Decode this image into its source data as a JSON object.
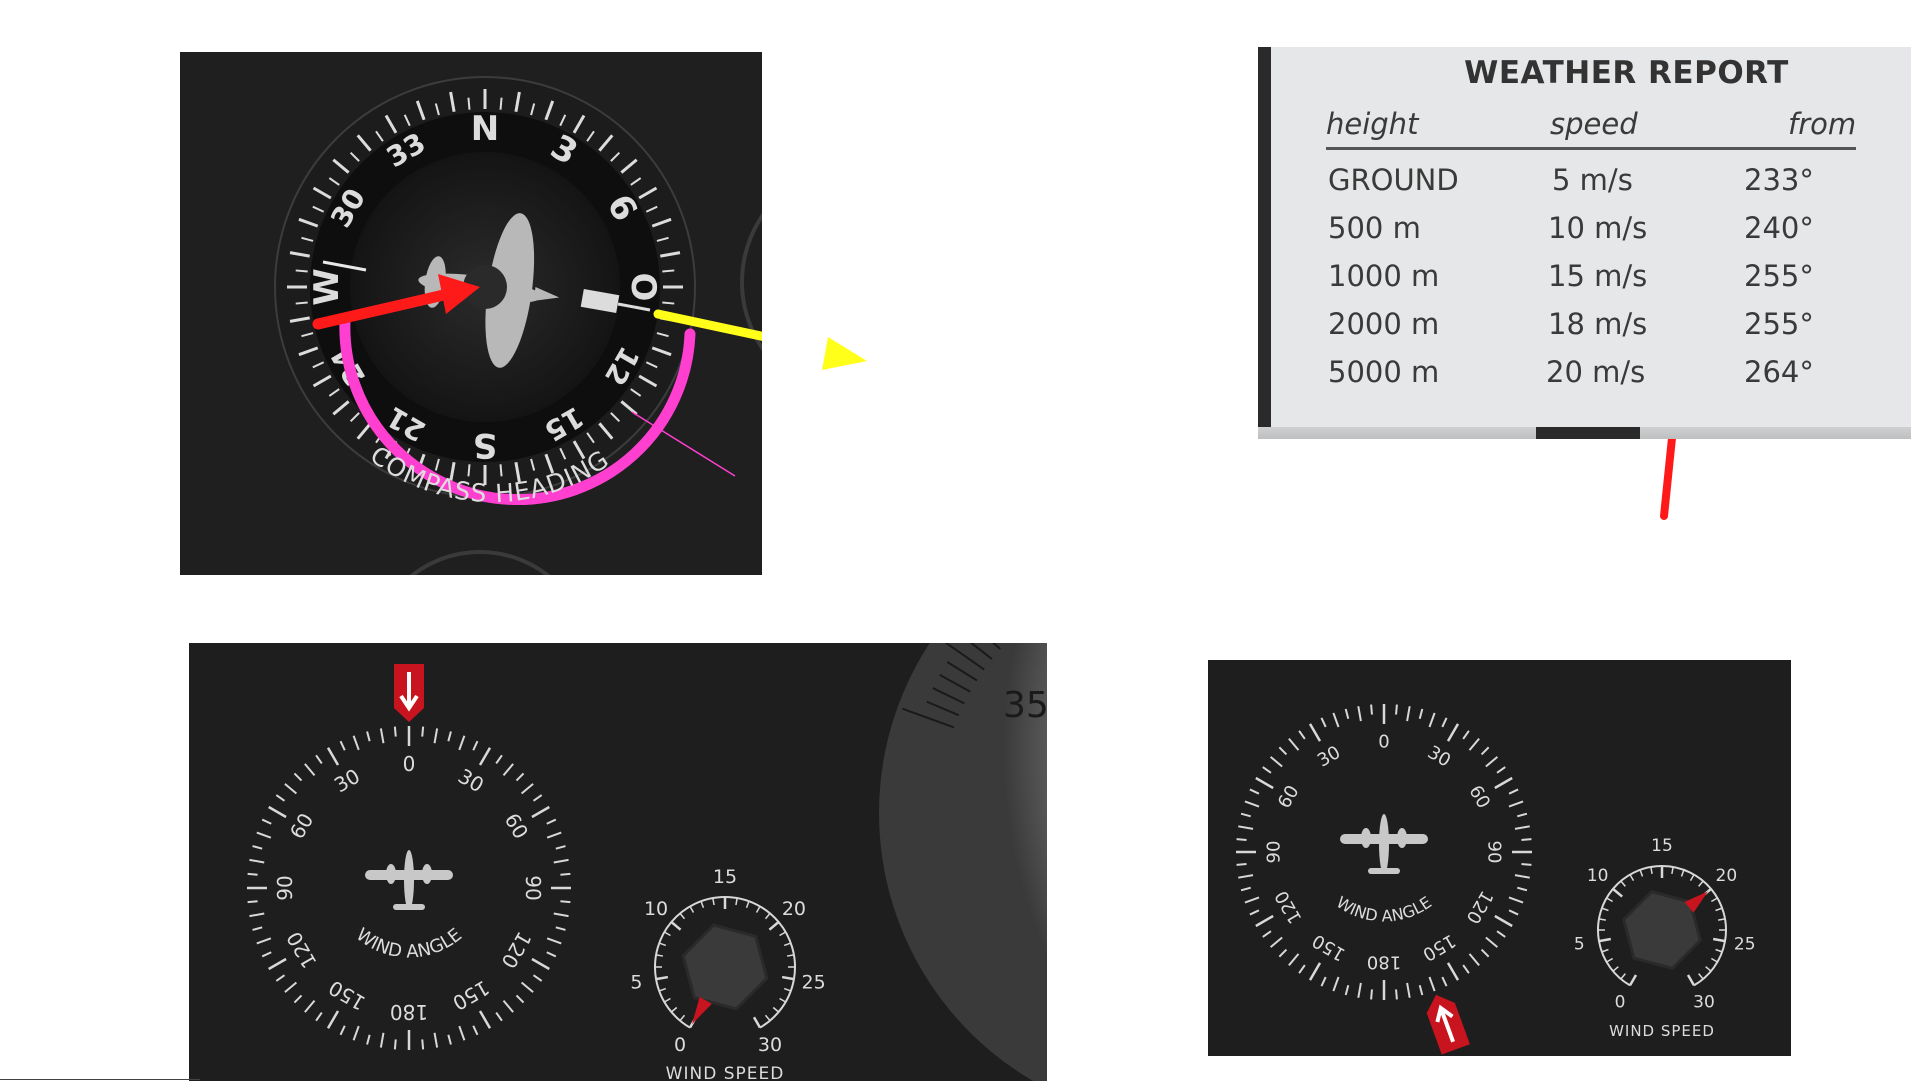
{
  "compass": {
    "caption": "COMPASS HEADING",
    "cardinal_labels": [
      "N",
      "3",
      "6",
      "O",
      "12",
      "15",
      "S",
      "21",
      "24",
      "W",
      "30",
      "33"
    ]
  },
  "weather_report": {
    "title": "WEATHER REPORT",
    "columns": [
      "height",
      "speed",
      "from"
    ],
    "rows": [
      {
        "height": "GROUND",
        "speed": "5 m/s",
        "from": "233°"
      },
      {
        "height": "500 m",
        "speed": "10 m/s",
        "from": "240°"
      },
      {
        "height": "1000 m",
        "speed": "15 m/s",
        "from": "255°"
      },
      {
        "height": "2000 m",
        "speed": "18 m/s",
        "from": "255°"
      },
      {
        "height": "5000 m",
        "speed": "20 m/s",
        "from": "264°"
      }
    ]
  },
  "wind_instrument_1": {
    "angle_caption": "WIND ANGLE",
    "angle_labels": [
      "0",
      "30",
      "60",
      "90",
      "120",
      "150",
      "180",
      "150",
      "120",
      "90",
      "60",
      "30"
    ],
    "wind_angle_deg": 0,
    "speed_caption": "WIND SPEED",
    "speed_labels": [
      "0",
      "5",
      "10",
      "15",
      "20",
      "25",
      "30"
    ],
    "wind_speed": 0,
    "altimeter_reading": "35"
  },
  "wind_instrument_2": {
    "angle_caption": "WIND ANGLE",
    "angle_labels": [
      "0",
      "30",
      "60",
      "90",
      "120",
      "150",
      "180",
      "150",
      "120",
      "90",
      "60",
      "30"
    ],
    "wind_angle_deg": 160,
    "speed_caption": "WIND SPEED",
    "speed_labels": [
      "0",
      "5",
      "10",
      "15",
      "20",
      "25",
      "30"
    ],
    "wind_speed": 20
  },
  "colors": {
    "panel_bg": "#1f1f1f",
    "annotation_red": "#ff1a1a",
    "annotation_yellow": "#ffff1a",
    "annotation_magenta": "#ff3fd0",
    "pointer_red": "#c8141e"
  }
}
